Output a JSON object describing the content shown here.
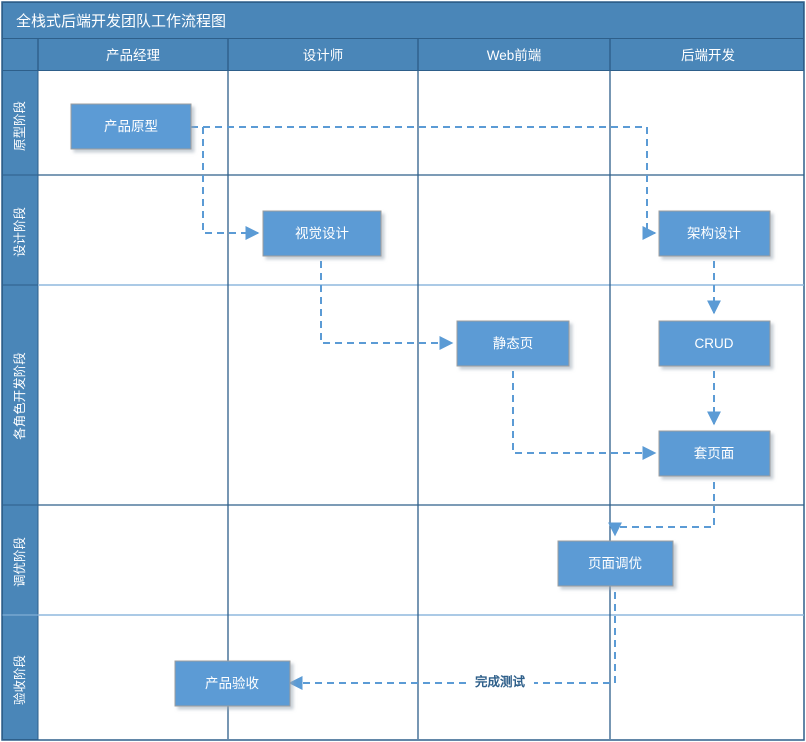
{
  "diagram": {
    "title": "全栈式后端开发团队工作流程图",
    "type": "swimlane-flowchart",
    "colors": {
      "title_bar_bg": "#4a86b8",
      "header_bg": "#4a86b8",
      "lane_label_bg": "#4a86b8",
      "node_fill": "#5b9bd5",
      "node_stroke": "#9d9d9d",
      "node_text": "#ffffff",
      "connector": "#5b9bd5",
      "grid_line": "#2e5f8a",
      "canvas_bg": "#ffffff",
      "header_text": "#ffffff"
    },
    "columns": [
      {
        "id": "pm",
        "label": "产品经理"
      },
      {
        "id": "designer",
        "label": "设计师"
      },
      {
        "id": "web",
        "label": "Web前端"
      },
      {
        "id": "backend",
        "label": "后端开发"
      }
    ],
    "lanes": [
      {
        "id": "prototype",
        "label": "原型阶段"
      },
      {
        "id": "design",
        "label": "设计阶段"
      },
      {
        "id": "development",
        "label": "各角色开发阶段"
      },
      {
        "id": "tuning",
        "label": "调优阶段"
      },
      {
        "id": "acceptance",
        "label": "验收阶段"
      }
    ],
    "nodes": [
      {
        "id": "n1",
        "label": "产品原型",
        "column": "pm",
        "lane": "prototype"
      },
      {
        "id": "n2",
        "label": "视觉设计",
        "column": "designer",
        "lane": "design"
      },
      {
        "id": "n3",
        "label": "架构设计",
        "column": "backend",
        "lane": "design"
      },
      {
        "id": "n4",
        "label": "静态页",
        "column": "web",
        "lane": "development"
      },
      {
        "id": "n5",
        "label": "CRUD",
        "column": "backend",
        "lane": "development"
      },
      {
        "id": "n6",
        "label": "套页面",
        "column": "backend",
        "lane": "development"
      },
      {
        "id": "n7",
        "label": "页面调优",
        "column": "web",
        "lane": "tuning"
      },
      {
        "id": "n8",
        "label": "产品验收",
        "column": "pm",
        "lane": "acceptance"
      }
    ],
    "edges": [
      {
        "id": "e1",
        "from": "n1",
        "to": "n2",
        "label": ""
      },
      {
        "id": "e2",
        "from": "n1",
        "to": "n3",
        "label": ""
      },
      {
        "id": "e3",
        "from": "n2",
        "to": "n4",
        "label": ""
      },
      {
        "id": "e4",
        "from": "n3",
        "to": "n5",
        "label": ""
      },
      {
        "id": "e5",
        "from": "n5",
        "to": "n6",
        "label": ""
      },
      {
        "id": "e6",
        "from": "n4",
        "to": "n6",
        "label": ""
      },
      {
        "id": "e7",
        "from": "n6",
        "to": "n7",
        "label": ""
      },
      {
        "id": "e8",
        "from": "n7",
        "to": "n8",
        "label": "完成测试"
      }
    ]
  }
}
